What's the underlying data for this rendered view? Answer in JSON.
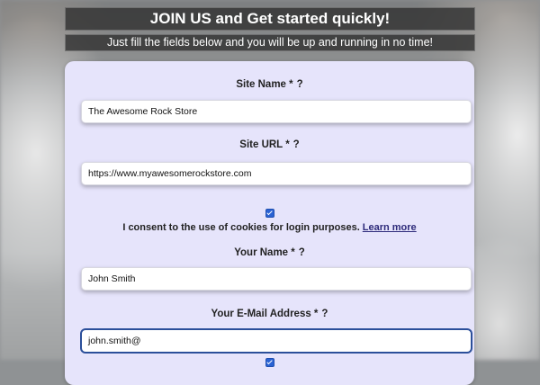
{
  "header": {
    "title": "JOIN US and Get started quickly!",
    "subtitle": "Just fill the fields below and you will be up and running in no time!"
  },
  "form": {
    "site_name": {
      "label": "Site Name *",
      "help": "?",
      "value": "The Awesome Rock Store"
    },
    "site_url": {
      "label": "Site URL *",
      "help": "?",
      "value": "https://www.myawesomerockstore.com"
    },
    "consent": {
      "checked": true,
      "text": "I consent to the use of cookies for login purposes.",
      "link": "Learn more"
    },
    "your_name": {
      "label": "Your Name *",
      "help": "?",
      "value": "John Smith"
    },
    "email": {
      "label": "Your E-Mail Address *",
      "help": "?",
      "value": "john.smith@"
    }
  },
  "colors": {
    "card_bg": "#e6e4fb",
    "checkbox": "#2a62d3",
    "focus_border": "#2b4f9a"
  }
}
